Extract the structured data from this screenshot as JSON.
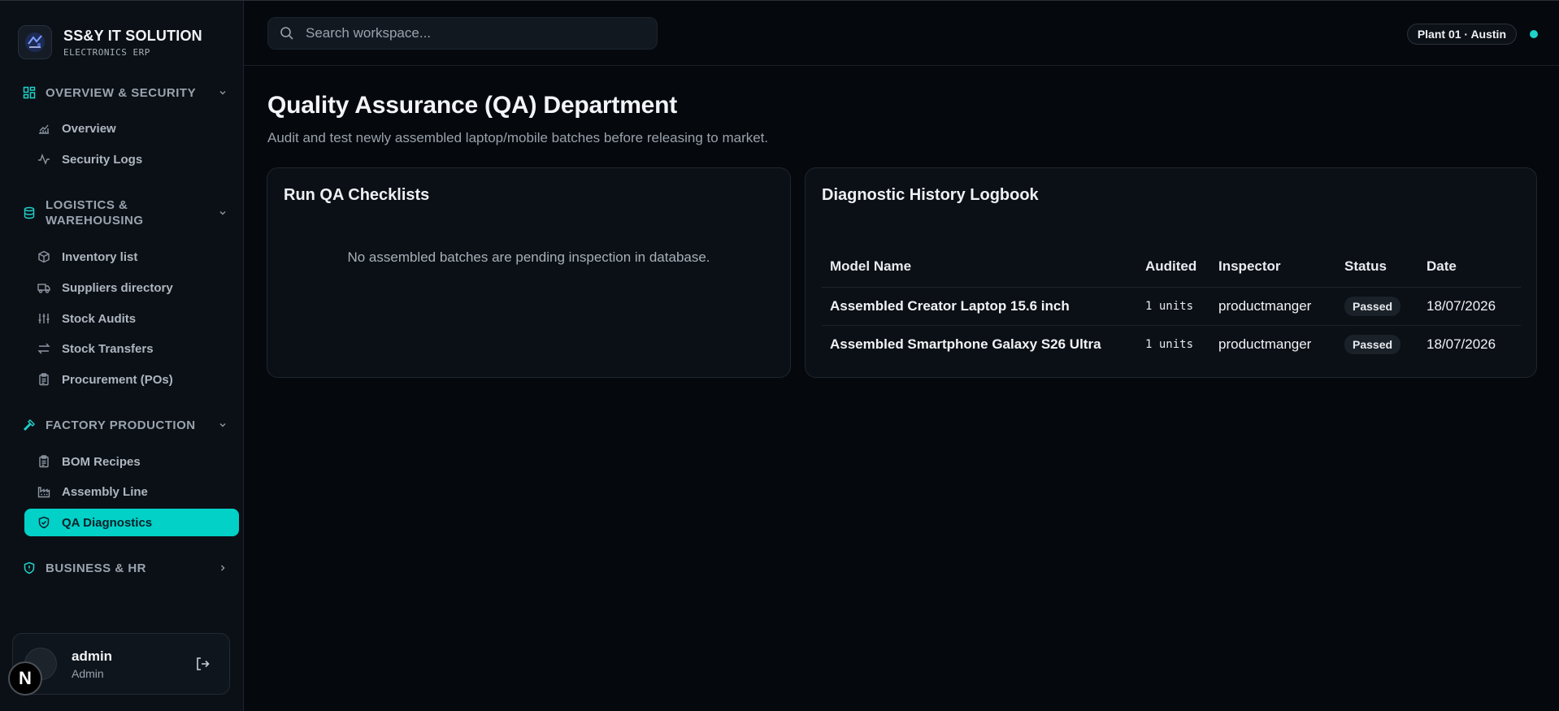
{
  "brand": {
    "title": "SS&Y IT SOLUTION",
    "subtitle": "ELECTRONICS ERP"
  },
  "sidebar": {
    "groups": [
      {
        "label": "OVERVIEW & SECURITY",
        "icon": "dashboard-grid-icon",
        "expanded": true,
        "items": [
          {
            "label": "Overview",
            "icon": "chart-icon"
          },
          {
            "label": "Security Logs",
            "icon": "activity-icon"
          }
        ]
      },
      {
        "label": "LOGISTICS & WAREHOUSING",
        "icon": "database-icon",
        "expanded": true,
        "items": [
          {
            "label": "Inventory list",
            "icon": "package-icon"
          },
          {
            "label": "Suppliers directory",
            "icon": "truck-icon"
          },
          {
            "label": "Stock Audits",
            "icon": "sliders-icon"
          },
          {
            "label": "Stock Transfers",
            "icon": "transfer-icon"
          },
          {
            "label": "Procurement (POs)",
            "icon": "clipboard-icon"
          }
        ]
      },
      {
        "label": "FACTORY PRODUCTION",
        "icon": "hammer-icon",
        "expanded": true,
        "items": [
          {
            "label": "BOM Recipes",
            "icon": "clipboard-icon"
          },
          {
            "label": "Assembly Line",
            "icon": "factory-icon"
          },
          {
            "label": "QA Diagnostics",
            "icon": "shield-check-icon",
            "active": true
          }
        ]
      },
      {
        "label": "BUSINESS & HR",
        "icon": "shield-icon",
        "expanded": false,
        "items": []
      }
    ]
  },
  "user": {
    "name": "admin",
    "role": "Admin",
    "avatar_letter": "N"
  },
  "search": {
    "placeholder": "Search workspace..."
  },
  "plant": {
    "label": "Plant 01 · Austin"
  },
  "page": {
    "title": "Quality Assurance (QA) Department",
    "subtitle": "Audit and test newly assembled laptop/mobile batches before releasing to market."
  },
  "checklists": {
    "title": "Run QA Checklists",
    "empty_message": "No assembled batches are pending inspection in database."
  },
  "logbook": {
    "title": "Diagnostic History Logbook",
    "columns": [
      "Model Name",
      "Audited",
      "Inspector",
      "Status",
      "Date"
    ],
    "rows": [
      {
        "model": "Assembled Creator Laptop 15.6 inch",
        "audited": "1 units",
        "inspector": "productmanger",
        "status": "Passed",
        "date": "18/07/2026"
      },
      {
        "model": "Assembled Smartphone Galaxy S26 Ultra",
        "audited": "1 units",
        "inspector": "productmanger",
        "status": "Passed",
        "date": "18/07/2026"
      }
    ]
  },
  "colors": {
    "accent": "#02d1c8",
    "background": "#05080d",
    "sidebar": "#0b1016"
  }
}
